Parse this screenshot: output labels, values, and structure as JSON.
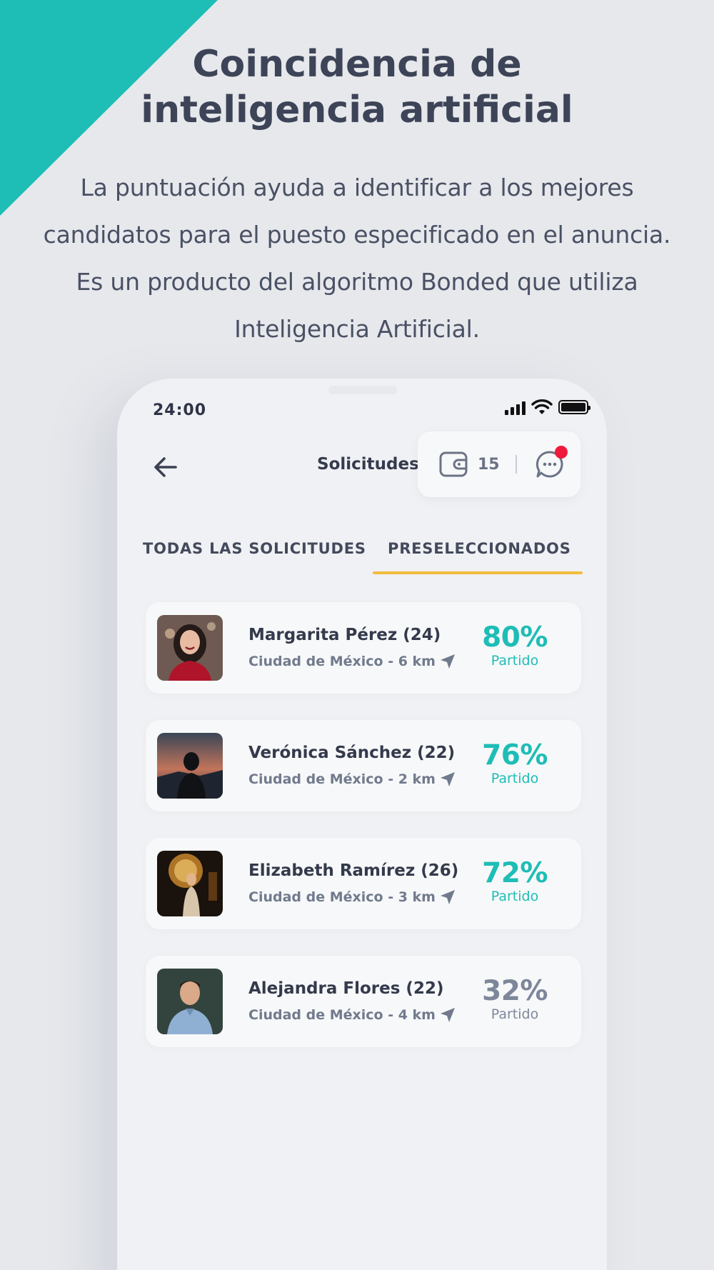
{
  "colors": {
    "accent_teal": "#1ebdb6",
    "tab_underline": "#f2bd3c",
    "notification": "#ef1a3b",
    "text_dark": "#3d4457",
    "low_match": "#7d869a"
  },
  "hero": {
    "title_line1": "Coincidencia de",
    "title_line2": "inteligencia artificial",
    "description": "La puntuación ayuda a identificar a los mejores candidatos para el puesto especificado en el anuncia. Es un producto del algoritmo Bonded que utiliza Inteligencia Artificial."
  },
  "status_bar": {
    "time": "24:00",
    "icons": [
      "signal-icon",
      "wifi-icon",
      "battery-icon"
    ]
  },
  "header": {
    "back_icon": "arrow-left-icon",
    "title": "Solicitudes",
    "wallet_icon": "wallet-icon",
    "wallet_count": "15",
    "chat_icon": "chat-bubble-icon"
  },
  "tabs": [
    {
      "label": "TODAS LAS SOLICITUDES",
      "active": false
    },
    {
      "label": "PRESELECCIONADOS",
      "active": true
    }
  ],
  "candidates": [
    {
      "name": "Margarita Pérez (24)",
      "location": "Ciudad de México - 6 km",
      "match": "80%",
      "match_label": "Partido",
      "color": "#1ebdb6"
    },
    {
      "name": "Verónica Sánchez (22)",
      "location": "Ciudad de México - 2 km",
      "match": "76%",
      "match_label": "Partido",
      "color": "#1ebdb6"
    },
    {
      "name": "Elizabeth Ramírez (26)",
      "location": "Ciudad de México - 3 km",
      "match": "72%",
      "match_label": "Partido",
      "color": "#1ebdb6"
    },
    {
      "name": "Alejandra Flores  (22)",
      "location": "Ciudad de México - 4 km",
      "match": "32%",
      "match_label": "Partido",
      "color": "#7d869a"
    }
  ]
}
